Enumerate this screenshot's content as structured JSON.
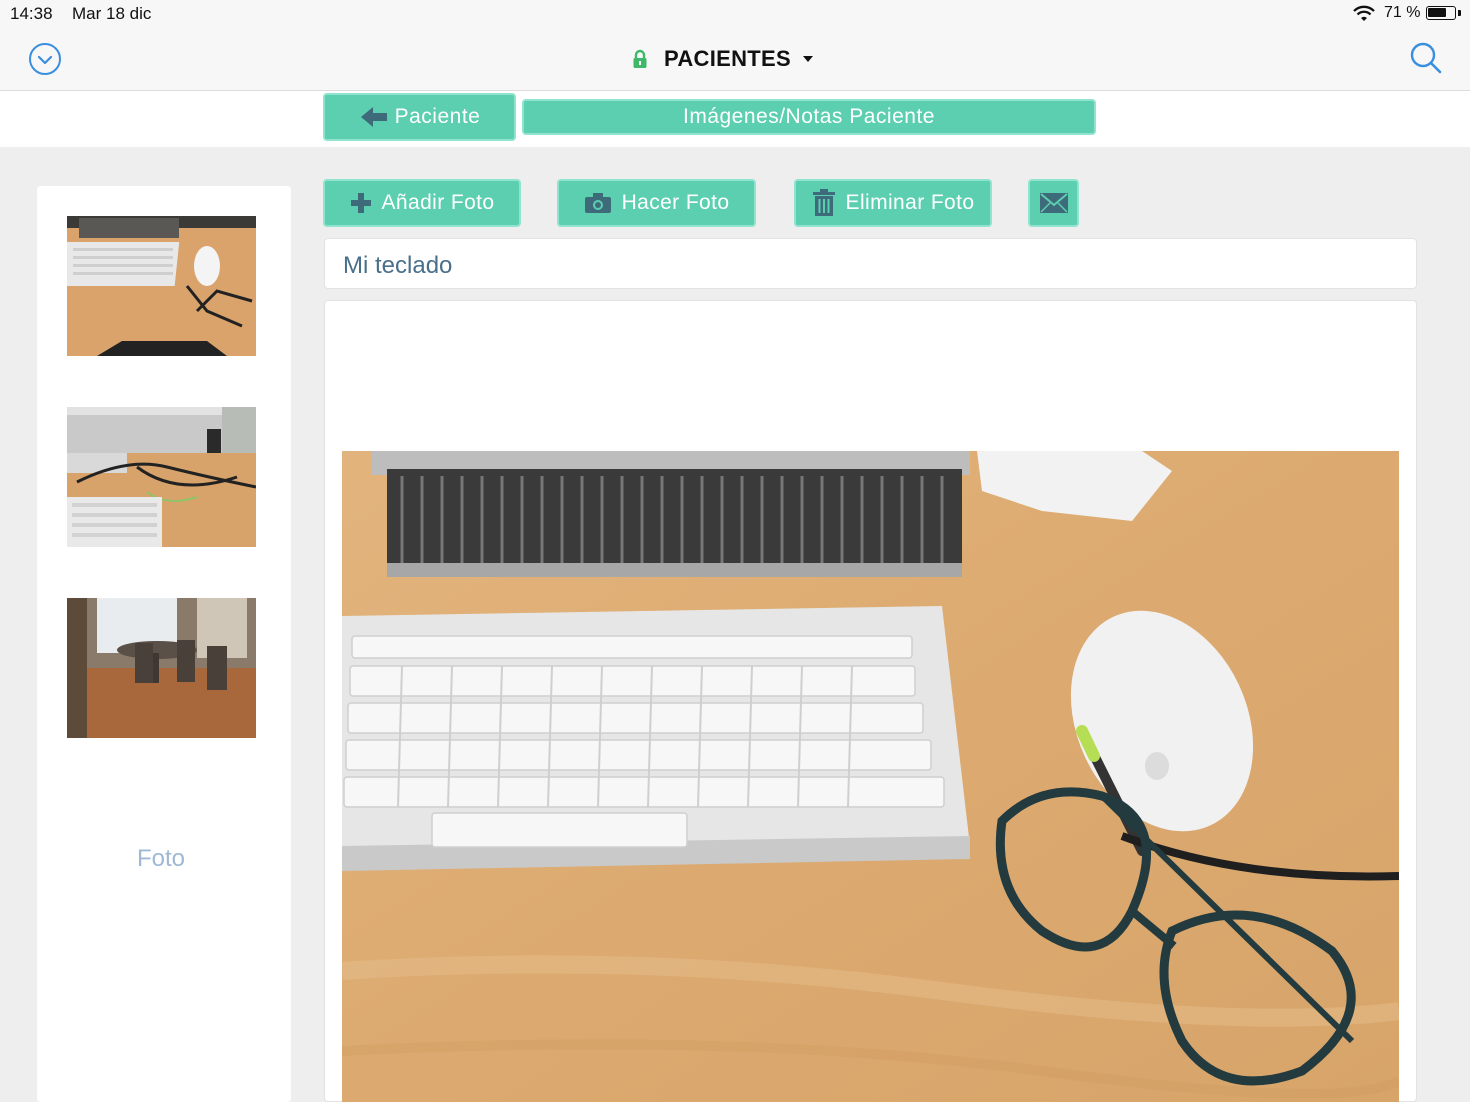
{
  "status_bar": {
    "time": "14:38",
    "date": "Mar 18 dic",
    "battery_text": "71 %",
    "battery_level": 0.71
  },
  "nav": {
    "title": "PACIENTES",
    "icons": {
      "left": "chevron-down-circle-icon",
      "lock": "lock-icon",
      "dropdown": "caret-down-icon",
      "right": "search-icon"
    }
  },
  "tabs": {
    "back_label": "Paciente",
    "images_label": "Imágenes/Notas Paciente"
  },
  "actions": {
    "add_label": "Añadir Foto",
    "take_label": "Hacer Foto",
    "delete_label": "Eliminar Foto",
    "icons": [
      "plus-icon",
      "camera-icon",
      "trash-icon",
      "mail-icon"
    ]
  },
  "sidebar": {
    "thumbnails": [
      "photo-keyboard-desk",
      "photo-monitor-cables",
      "photo-meeting-room"
    ],
    "foto_label": "Foto"
  },
  "note": {
    "value": "Mi teclado"
  },
  "colors": {
    "accent": "#5ccfb1",
    "accent_border": "#8fe3cf",
    "link_blue": "#3a8ee0",
    "lock_green": "#3fb86a"
  }
}
